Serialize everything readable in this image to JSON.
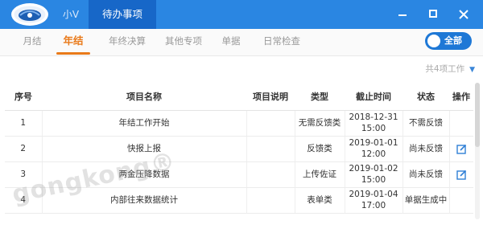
{
  "titlebar": {
    "home_tab": "小V",
    "active_tab": "待办事项",
    "bg_color": "#2a86e2",
    "active_color": "#1767c8",
    "logo_icon": "app-logo-icon",
    "min_icon": "minimize-icon",
    "max_icon": "maximize-icon",
    "close_icon": "close-icon"
  },
  "subtabs": {
    "items": [
      "月结",
      "年结",
      "年终决算",
      "其他专项",
      "单据",
      "日常检查"
    ],
    "active_index": 1,
    "active_color": "#e97a1a"
  },
  "toggle": {
    "label": "全部",
    "color": "#1e78d6",
    "state": "on"
  },
  "summary": {
    "count_text": "共4项工作",
    "caret_icon": "chevron-down-icon"
  },
  "table": {
    "headers": [
      "序号",
      "项目名称",
      "项目说明",
      "类型",
      "截止时间",
      "状态",
      "操作"
    ],
    "rows": [
      {
        "no": "1",
        "name": "年结工作开始",
        "desc": "",
        "type": "无需反馈类",
        "date": "2018-12-31",
        "time": "15:00",
        "status": "不需反馈",
        "action": ""
      },
      {
        "no": "2",
        "name": "快报上报",
        "desc": "",
        "type": "反馈类",
        "date": "2019-01-01",
        "time": "12:00",
        "status": "尚未反馈",
        "action": "edit"
      },
      {
        "no": "3",
        "name": "两金压降数据",
        "desc": "",
        "type": "上传佐证",
        "date": "2019-01-02",
        "time": "15:00",
        "status": "尚未反馈",
        "action": "edit"
      },
      {
        "no": "4",
        "name": "内部往来数据统计",
        "desc": "",
        "type": "表单类",
        "date": "2019-01-04",
        "time": "17:00",
        "status": "单据生成中",
        "action": ""
      }
    ]
  },
  "watermark": "gongkong®",
  "colors": {
    "accent": "#e97a1a",
    "edit_icon": "#2f7fd6"
  }
}
